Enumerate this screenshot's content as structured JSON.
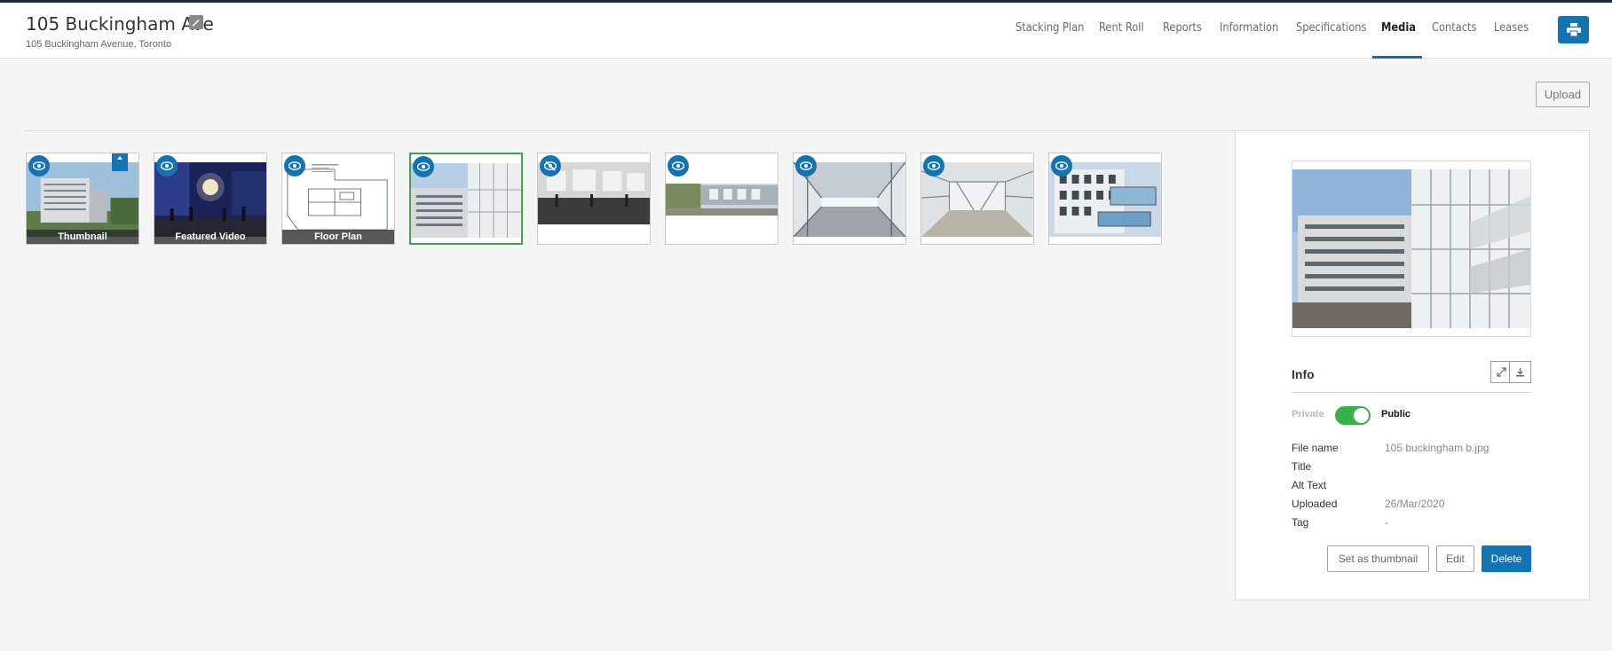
{
  "building": {
    "title": "105 Buckingham Ave",
    "address": "105 Buckingham Avenue, Toronto"
  },
  "nav": {
    "items": [
      {
        "label": "Stacking Plan",
        "active": false
      },
      {
        "label": "Rent Roll",
        "active": false
      },
      {
        "label": "Reports",
        "active": false
      },
      {
        "label": "Information",
        "active": false
      },
      {
        "label": "Specifications",
        "active": false
      },
      {
        "label": "Media",
        "active": true
      },
      {
        "label": "Contacts",
        "active": false
      },
      {
        "label": "Leases",
        "active": false
      }
    ],
    "print_icon": "printer-icon"
  },
  "media": {
    "upload_label": "Upload",
    "thumbnails": [
      {
        "caption": "Thumbnail",
        "visibility_icon": "eye-icon",
        "pinned": true
      },
      {
        "caption": "Featured Video",
        "visibility_icon": "eye-icon"
      },
      {
        "caption": "Floor Plan",
        "visibility_icon": "eye-icon"
      },
      {
        "caption": "",
        "visibility_icon": "eye-icon",
        "selected": true
      },
      {
        "caption": "",
        "visibility_icon": "eye-slash-icon"
      },
      {
        "caption": "",
        "visibility_icon": "eye-icon"
      },
      {
        "caption": "",
        "visibility_icon": "eye-icon"
      },
      {
        "caption": "",
        "visibility_icon": "eye-icon"
      },
      {
        "caption": "",
        "visibility_icon": "eye-icon"
      }
    ]
  },
  "info": {
    "heading": "Info",
    "private_label": "Private",
    "public_label": "Public",
    "is_public": true,
    "fields": [
      {
        "label": "File name",
        "value": "105 buckingham b.jpg"
      },
      {
        "label": "Title",
        "value": ""
      },
      {
        "label": "Alt Text",
        "value": ""
      },
      {
        "label": "Uploaded",
        "value": "26/Mar/2020"
      },
      {
        "label": "Tag",
        "value": "-"
      }
    ],
    "set_thumbnail_label": "Set as thumbnail",
    "edit_label": "Edit",
    "delete_label": "Delete"
  },
  "colors": {
    "accent": "#1473b0",
    "toggle_on": "#3ab04b",
    "selected_border": "#3aa84e"
  }
}
